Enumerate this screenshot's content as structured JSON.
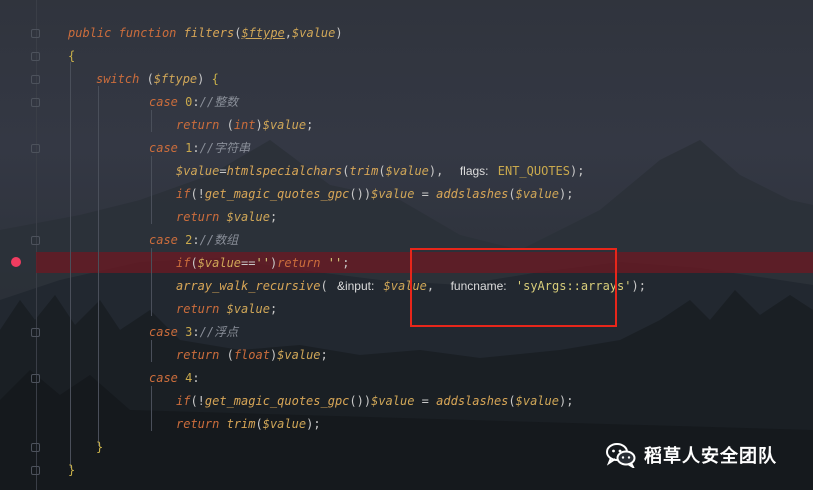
{
  "code_lines": [
    {
      "id": "l1",
      "tokens": [
        [
          "kw",
          "public"
        ],
        [
          "punc",
          " "
        ],
        [
          "kw",
          "function"
        ],
        [
          "punc",
          " "
        ],
        [
          "fn",
          "filters"
        ],
        [
          "punc",
          "("
        ],
        [
          "var-u",
          "$ftype"
        ],
        [
          "punc",
          ","
        ],
        [
          "var",
          "$value"
        ],
        [
          "punc",
          ")"
        ]
      ]
    },
    {
      "id": "l2",
      "tokens": [
        [
          "brace",
          "{"
        ]
      ]
    },
    {
      "id": "l3",
      "tokens": [
        [
          "kw",
          "switch"
        ],
        [
          "punc",
          " ("
        ],
        [
          "var",
          "$ftype"
        ],
        [
          "punc",
          ") "
        ],
        [
          "brace",
          "{"
        ]
      ]
    },
    {
      "id": "l4",
      "tokens": [
        [
          "kw",
          "case"
        ],
        [
          "punc",
          " "
        ],
        [
          "const",
          "0"
        ],
        [
          "punc",
          ":"
        ],
        [
          "cmt",
          "//"
        ],
        [
          "cmt-cn",
          "整数"
        ]
      ]
    },
    {
      "id": "l5",
      "tokens": [
        [
          "kw",
          "return"
        ],
        [
          "punc",
          " ("
        ],
        [
          "kw",
          "int"
        ],
        [
          "punc",
          ")"
        ],
        [
          "var",
          "$value"
        ],
        [
          "punc",
          ";"
        ]
      ]
    },
    {
      "id": "l6",
      "tokens": [
        [
          "kw",
          "case"
        ],
        [
          "punc",
          " "
        ],
        [
          "const",
          "1"
        ],
        [
          "punc",
          ":"
        ],
        [
          "cmt",
          "//"
        ],
        [
          "cmt-cn",
          "字符串"
        ]
      ]
    },
    {
      "id": "l7",
      "tokens": [
        [
          "var",
          "$value"
        ],
        [
          "punc",
          "="
        ],
        [
          "fn",
          "htmlspecialchars"
        ],
        [
          "punc",
          "("
        ],
        [
          "fn",
          "trim"
        ],
        [
          "punc",
          "("
        ],
        [
          "var",
          "$value"
        ],
        [
          "punc",
          "),  "
        ],
        [
          "hint",
          "flags:"
        ],
        [
          "punc",
          " "
        ],
        [
          "const",
          "ENT_QUOTES"
        ],
        [
          "punc",
          ");"
        ]
      ]
    },
    {
      "id": "l8",
      "tokens": [
        [
          "kw",
          "if"
        ],
        [
          "punc",
          "(!"
        ],
        [
          "fn",
          "get_magic_quotes_gpc"
        ],
        [
          "punc",
          "())"
        ],
        [
          "var",
          "$value"
        ],
        [
          "punc",
          " = "
        ],
        [
          "fn",
          "addslashes"
        ],
        [
          "punc",
          "("
        ],
        [
          "var",
          "$value"
        ],
        [
          "punc",
          ");"
        ]
      ]
    },
    {
      "id": "l9",
      "tokens": [
        [
          "kw",
          "return"
        ],
        [
          "punc",
          " "
        ],
        [
          "var",
          "$value"
        ],
        [
          "punc",
          ";"
        ]
      ]
    },
    {
      "id": "l10",
      "tokens": [
        [
          "kw",
          "case"
        ],
        [
          "punc",
          " "
        ],
        [
          "const",
          "2"
        ],
        [
          "punc",
          ":"
        ],
        [
          "cmt",
          "//"
        ],
        [
          "cmt-cn",
          "数组"
        ]
      ]
    },
    {
      "id": "l11",
      "tokens": [
        [
          "kw",
          "if"
        ],
        [
          "punc",
          "("
        ],
        [
          "var",
          "$value"
        ],
        [
          "punc",
          "=="
        ],
        [
          "str",
          "''"
        ],
        [
          "punc",
          ")"
        ],
        [
          "kw",
          "return"
        ],
        [
          "punc",
          " "
        ],
        [
          "str",
          "''"
        ],
        [
          "punc",
          ";"
        ]
      ]
    },
    {
      "id": "l12",
      "tokens": [
        [
          "fn",
          "array_walk_recursive"
        ],
        [
          "punc",
          "( "
        ],
        [
          "hint",
          "&input:"
        ],
        [
          "punc",
          " "
        ],
        [
          "var",
          "$value"
        ],
        [
          "punc",
          ",  "
        ],
        [
          "hint",
          "funcname:"
        ],
        [
          "punc",
          " "
        ],
        [
          "str",
          "'syArgs::arrays'"
        ],
        [
          "punc",
          ");"
        ]
      ]
    },
    {
      "id": "l13",
      "tokens": [
        [
          "kw",
          "return"
        ],
        [
          "punc",
          " "
        ],
        [
          "var",
          "$value"
        ],
        [
          "punc",
          ";"
        ]
      ]
    },
    {
      "id": "l14",
      "tokens": [
        [
          "kw",
          "case"
        ],
        [
          "punc",
          " "
        ],
        [
          "const",
          "3"
        ],
        [
          "punc",
          ":"
        ],
        [
          "cmt",
          "//"
        ],
        [
          "cmt-cn",
          "浮点"
        ]
      ]
    },
    {
      "id": "l15",
      "tokens": [
        [
          "kw",
          "return"
        ],
        [
          "punc",
          " ("
        ],
        [
          "kw",
          "float"
        ],
        [
          "punc",
          ")"
        ],
        [
          "var",
          "$value"
        ],
        [
          "punc",
          ";"
        ]
      ]
    },
    {
      "id": "l16",
      "tokens": [
        [
          "kw",
          "case"
        ],
        [
          "punc",
          " "
        ],
        [
          "const",
          "4"
        ],
        [
          "punc",
          ":"
        ]
      ]
    },
    {
      "id": "l17",
      "tokens": [
        [
          "kw",
          "if"
        ],
        [
          "punc",
          "(!"
        ],
        [
          "fn",
          "get_magic_quotes_gpc"
        ],
        [
          "punc",
          "())"
        ],
        [
          "var",
          "$value"
        ],
        [
          "punc",
          " = "
        ],
        [
          "fn",
          "addslashes"
        ],
        [
          "punc",
          "("
        ],
        [
          "var",
          "$value"
        ],
        [
          "punc",
          ");"
        ]
      ]
    },
    {
      "id": "l18",
      "tokens": [
        [
          "kw",
          "return"
        ],
        [
          "punc",
          " "
        ],
        [
          "fn",
          "trim"
        ],
        [
          "punc",
          "("
        ],
        [
          "var",
          "$value"
        ],
        [
          "punc",
          ");"
        ]
      ]
    },
    {
      "id": "l19",
      "tokens": [
        [
          "brace",
          "}"
        ]
      ]
    },
    {
      "id": "l20",
      "tokens": [
        [
          "brace",
          "}"
        ]
      ]
    }
  ],
  "breakpoint_line": 11,
  "highlight_box_color": "#e8261a",
  "watermark": {
    "icon": "wechat-icon",
    "text": "稻草人安全团队"
  }
}
